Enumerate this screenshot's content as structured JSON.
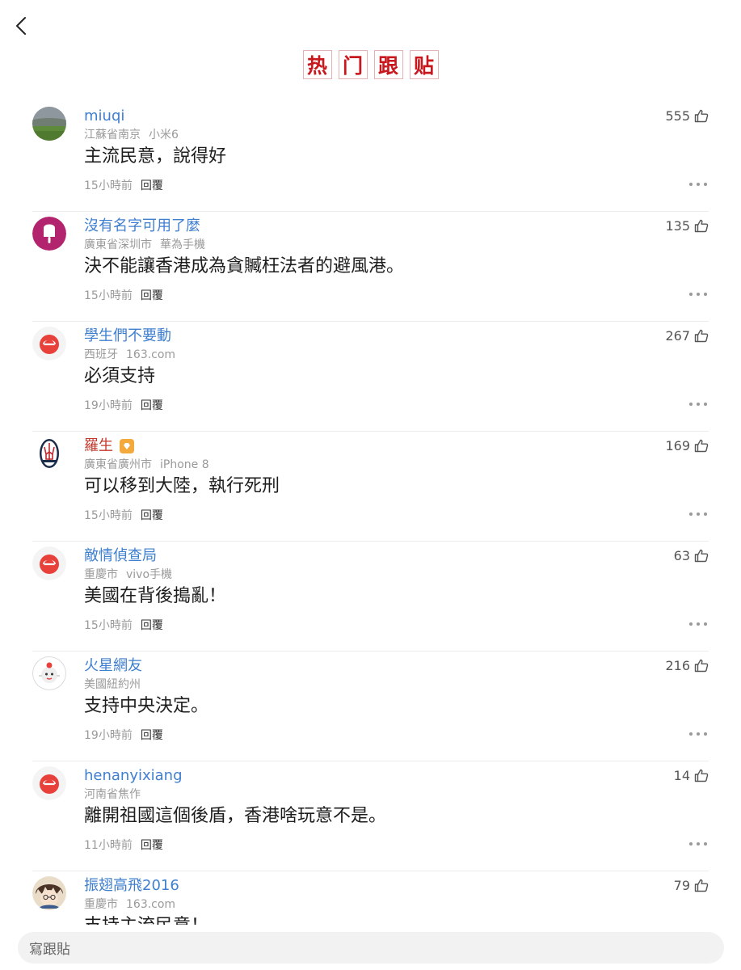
{
  "header": {
    "back_icon": "chevron-left-icon",
    "title_chars": [
      "热",
      "门",
      "跟",
      "贴"
    ]
  },
  "comments": [
    {
      "username": "miuqi",
      "location": "江蘇省南京",
      "device": "小米6",
      "text": "主流民意，說得好",
      "time": "15小時前",
      "reply": "回覆",
      "likes": "555",
      "avatar": "landscape"
    },
    {
      "username": "沒有名字可用了麼",
      "location": "廣東省深圳市",
      "device": "華為手機",
      "text": "決不能讓香港成為貪贓枉法者的避風港。",
      "time": "15小時前",
      "reply": "回覆",
      "likes": "135",
      "avatar": "popsicle"
    },
    {
      "username": "學生們不要動",
      "location": "西班牙",
      "device": "163.com",
      "text": "必須支持",
      "time": "19小時前",
      "reply": "回覆",
      "likes": "267",
      "avatar": "netease"
    },
    {
      "username": "羅生",
      "location": "廣東省廣州市",
      "device": "iPhone 8",
      "text": "可以移到大陸，執行死刑",
      "time": "15小時前",
      "reply": "回覆",
      "likes": "169",
      "avatar": "maserati",
      "vip": true
    },
    {
      "username": "敵情偵查局",
      "location": "重慶市",
      "device": "vivo手機",
      "text": "美國在背後搗亂！",
      "time": "15小時前",
      "reply": "回覆",
      "likes": "63",
      "avatar": "netease"
    },
    {
      "username": "火星網友",
      "location": "美國紐約州",
      "device": "",
      "text": "支持中央決定。",
      "time": "19小時前",
      "reply": "回覆",
      "likes": "216",
      "avatar": "mascot"
    },
    {
      "username": "henanyixiang",
      "location": "河南省焦作",
      "device": "",
      "text": "離開祖國這個後盾，香港啥玩意不是。",
      "time": "11小時前",
      "reply": "回覆",
      "likes": "14",
      "avatar": "netease"
    },
    {
      "username": "振翅高飛2016",
      "location": "重慶市",
      "device": "163.com",
      "text": "支持主流民意！",
      "time": "",
      "reply": "",
      "likes": "79",
      "avatar": "anime"
    }
  ],
  "composer": {
    "placeholder": "寫跟貼"
  },
  "colors": {
    "title_red": "#c8181e",
    "username_blue": "#3f7fcf",
    "vip_username": "#c33a2c",
    "netease_red": "#e8413b"
  }
}
